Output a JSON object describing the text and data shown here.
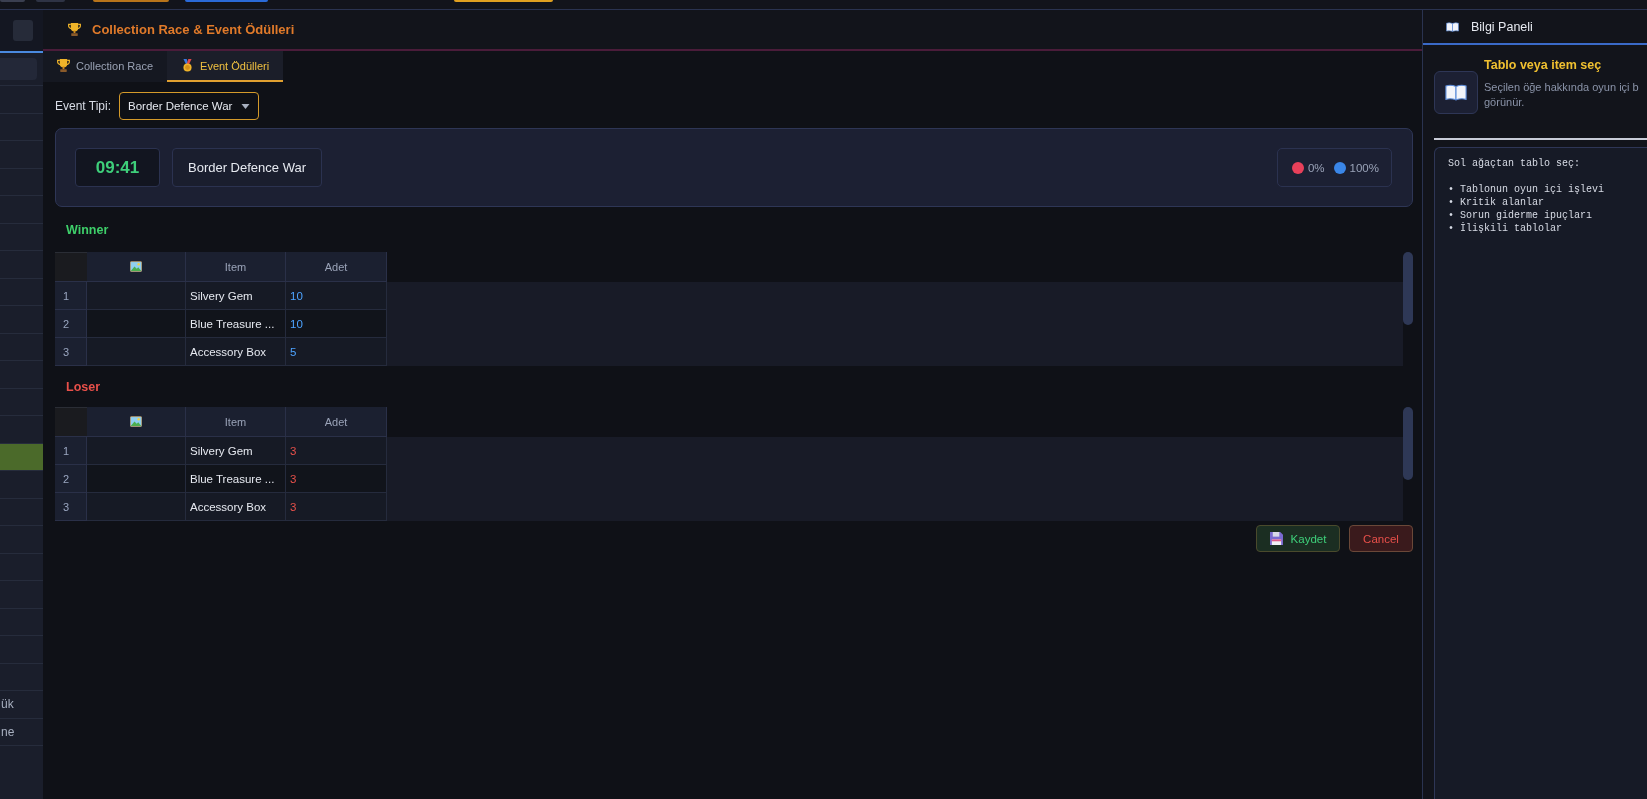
{
  "toolbar": {
    "buttons": [
      {
        "color": "#3a3f50"
      },
      {
        "color": "#2e3344"
      },
      {
        "color": "#b8741a"
      },
      {
        "color": "#2a6ad8"
      },
      {
        "color": "#e0a020"
      }
    ]
  },
  "sidebar": {
    "items": [
      {
        "selected": false
      },
      {
        "selected": false
      },
      {
        "selected": false
      },
      {
        "selected": false
      },
      {
        "selected": false
      },
      {
        "selected": false
      },
      {
        "selected": false
      },
      {
        "selected": false
      },
      {
        "selected": false
      },
      {
        "selected": false
      },
      {
        "selected": false
      },
      {
        "selected": false
      },
      {
        "selected": false
      },
      {
        "selected": true
      },
      {
        "selected": false
      },
      {
        "selected": false
      },
      {
        "selected": false
      },
      {
        "selected": false
      },
      {
        "selected": false
      },
      {
        "selected": false
      },
      {
        "selected": false
      },
      {
        "selected": false
      },
      {
        "label": "ük",
        "selected": false
      },
      {
        "label": "ne",
        "selected": false
      }
    ]
  },
  "panel": {
    "title": "Collection Race & Event Ödülleri",
    "tabs": [
      {
        "label": "Collection Race",
        "selected": false
      },
      {
        "label": "Event Ödülleri",
        "selected": true
      }
    ],
    "event_type": {
      "label": "Event Tipi:",
      "value": "Border Defence War"
    },
    "summary": {
      "time": "09:41",
      "event_name": "Border Defence War",
      "stats": [
        {
          "color": "#e8405a",
          "value": "0%"
        },
        {
          "color": "#3a86e8",
          "value": "100%"
        }
      ]
    },
    "tables": [
      {
        "kind": "winner",
        "title": "Winner",
        "columns": [
          "Item",
          "Adet"
        ],
        "rows": [
          {
            "number": "1",
            "item": "Silvery Gem",
            "count": "10"
          },
          {
            "number": "2",
            "item": "Blue Treasure ...",
            "count": "10"
          },
          {
            "number": "3",
            "item": "Accessory Box",
            "count": "5"
          }
        ]
      },
      {
        "kind": "loser",
        "title": "Loser",
        "columns": [
          "Item",
          "Adet"
        ],
        "rows": [
          {
            "number": "1",
            "item": "Silvery Gem",
            "count": "3"
          },
          {
            "number": "2",
            "item": "Blue Treasure ...",
            "count": "3"
          },
          {
            "number": "3",
            "item": "Accessory Box",
            "count": "3"
          }
        ]
      }
    ],
    "buttons": [
      {
        "kind": "save",
        "label": "Kaydet"
      },
      {
        "kind": "cancel",
        "label": "Cancel"
      }
    ]
  },
  "info_panel": {
    "title": "Bilgi Paneli",
    "card": {
      "title": "Tablo veya item seç",
      "description": "Seçilen öğe hakkında oyun içi b\ngörünür."
    },
    "help": {
      "intro": "Sol ağaçtan tablo seç:",
      "items": [
        "• Tablonun oyun içi işlevi",
        "• Kritik alanlar",
        "• Sorun giderme ipuçları",
        "• İlişkili tablolar"
      ]
    }
  }
}
